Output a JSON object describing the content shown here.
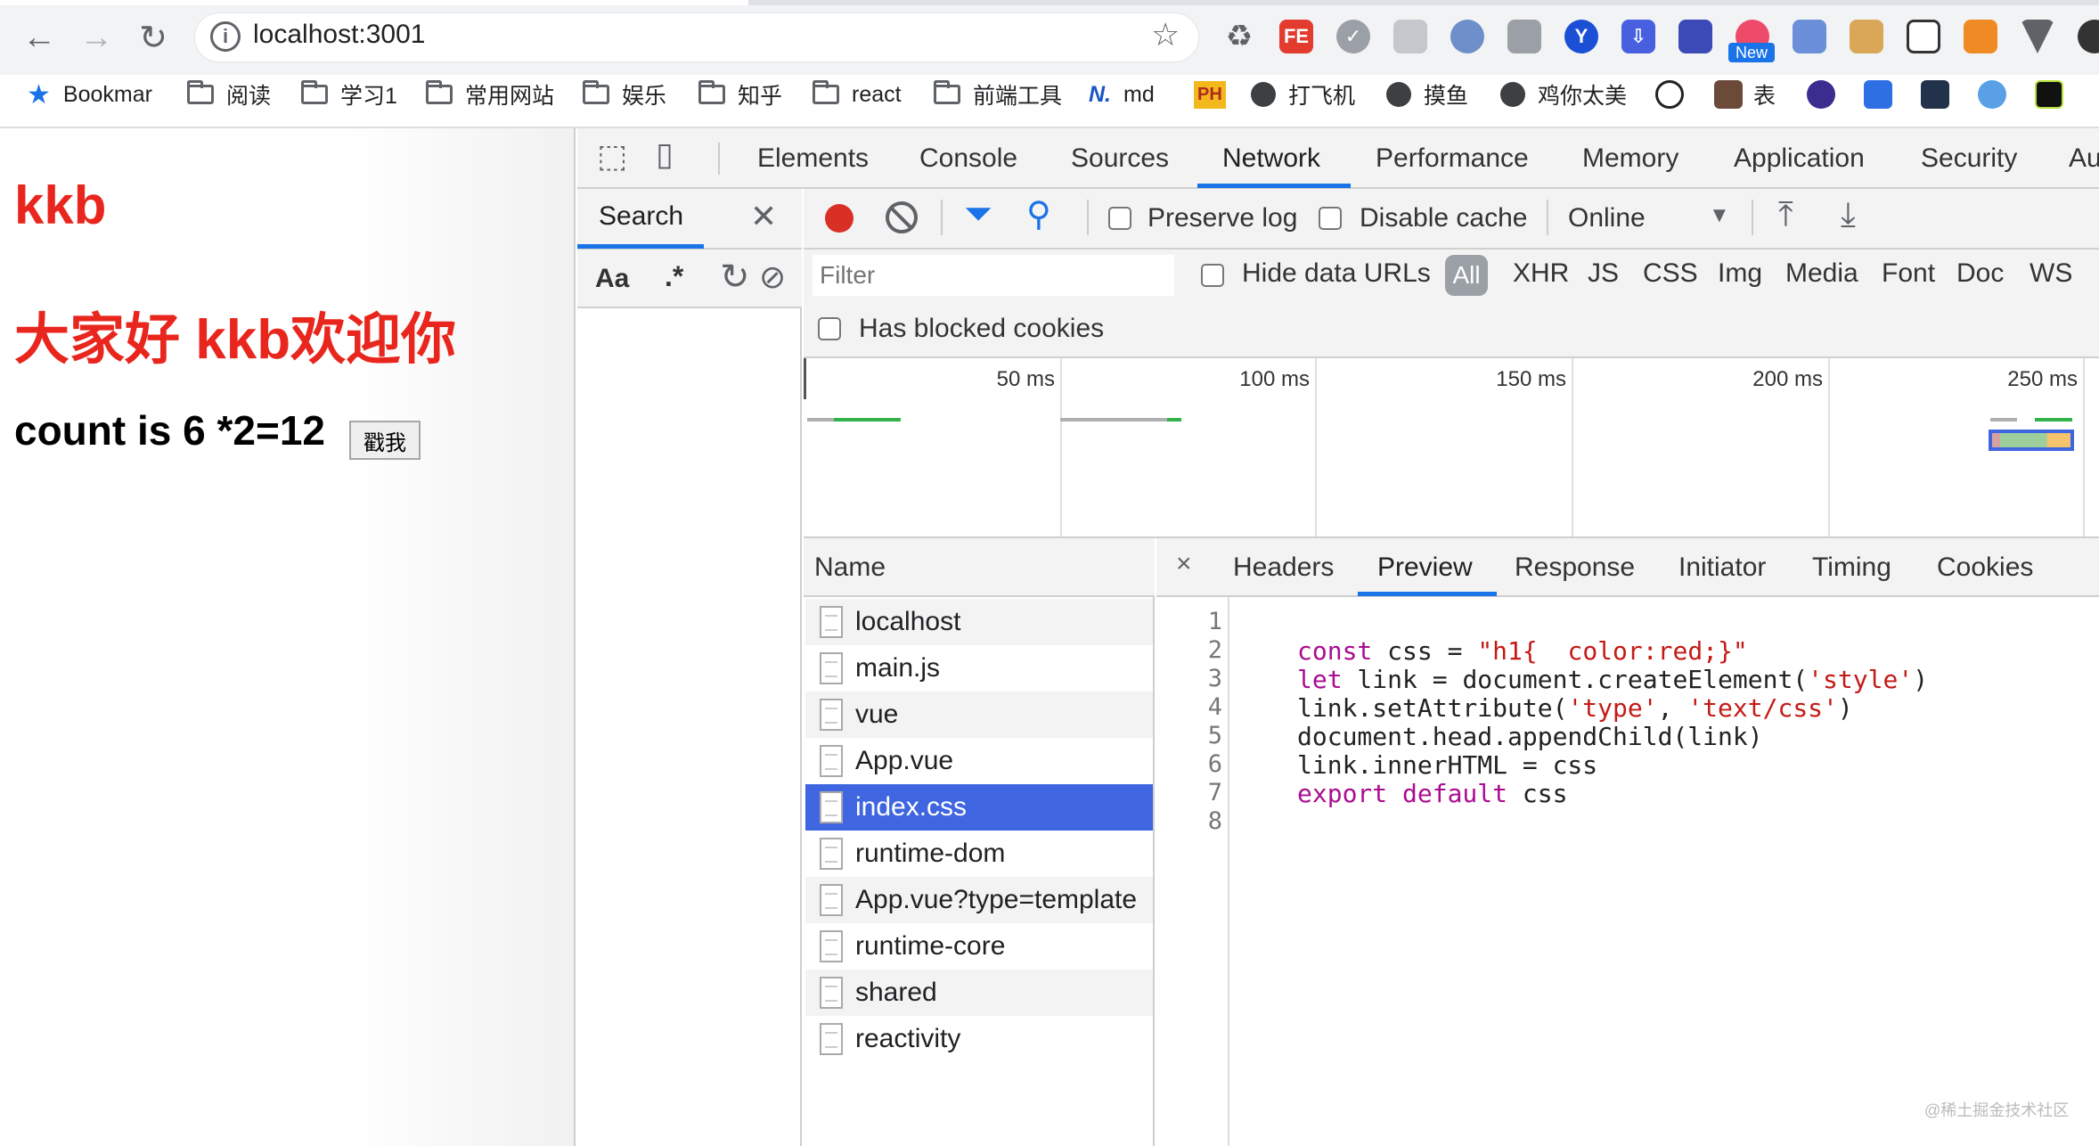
{
  "browser": {
    "url": "localhost:3001",
    "bookmarks": [
      "Bookmar",
      "阅读",
      "学习1",
      "常用网站",
      "娱乐",
      "知乎",
      "react",
      "前端工具",
      "md",
      "打飞机",
      "摸鱼",
      "鸡你太美",
      "表"
    ],
    "ext_badge": "New",
    "ext_fe": "FE",
    "ext_ph": "PH"
  },
  "page": {
    "heading1": "kkb",
    "heading2": "大家好 kkb欢迎你",
    "count_text": "count is 6 *2=12",
    "button_label": "戳我"
  },
  "devtools": {
    "tabs": [
      "Elements",
      "Console",
      "Sources",
      "Network",
      "Performance",
      "Memory",
      "Application",
      "Security",
      "Au"
    ],
    "active_tab": "Network",
    "search": {
      "title": "Search",
      "case_label": "Aa",
      "regex_label": ".*"
    },
    "network": {
      "preserve_log": "Preserve log",
      "disable_cache": "Disable cache",
      "throttle": "Online",
      "filter_placeholder": "Filter",
      "hide_data_urls": "Hide data URLs",
      "type_filters": [
        "All",
        "XHR",
        "JS",
        "CSS",
        "Img",
        "Media",
        "Font",
        "Doc",
        "WS"
      ],
      "has_blocked_cookies": "Has blocked cookies",
      "timeline_ticks": [
        "50 ms",
        "100 ms",
        "150 ms",
        "200 ms",
        "250 ms"
      ]
    },
    "requests": {
      "name_header": "Name",
      "rows": [
        "localhost",
        "main.js",
        "vue",
        "App.vue",
        "index.css",
        "runtime-dom",
        "App.vue?type=template",
        "runtime-core",
        "shared",
        "reactivity"
      ],
      "selected": "index.css"
    },
    "detail": {
      "tabs": [
        "Headers",
        "Preview",
        "Response",
        "Initiator",
        "Timing",
        "Cookies"
      ],
      "active_tab": "Preview",
      "line_numbers": [
        "1",
        "2",
        "3",
        "4",
        "5",
        "6",
        "7",
        "8"
      ]
    }
  },
  "watermark": "@稀土掘金技术社区",
  "colors": {
    "accent": "#1a73e8",
    "heading": "#e8261d",
    "selected_row": "#3f66e0"
  }
}
